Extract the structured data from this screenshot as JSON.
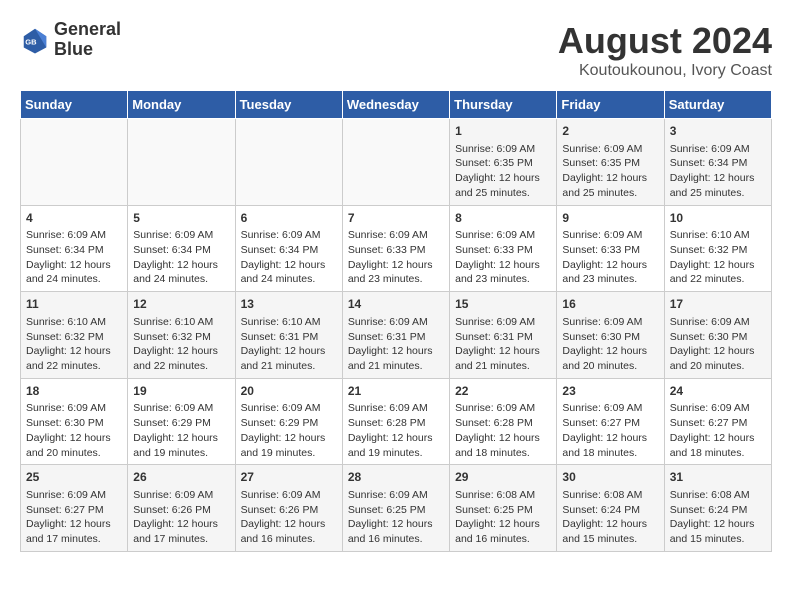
{
  "header": {
    "logo_line1": "General",
    "logo_line2": "Blue",
    "main_title": "August 2024",
    "sub_title": "Koutoukounou, Ivory Coast"
  },
  "calendar": {
    "weekdays": [
      "Sunday",
      "Monday",
      "Tuesday",
      "Wednesday",
      "Thursday",
      "Friday",
      "Saturday"
    ],
    "weeks": [
      [
        {
          "day": "",
          "content": ""
        },
        {
          "day": "",
          "content": ""
        },
        {
          "day": "",
          "content": ""
        },
        {
          "day": "",
          "content": ""
        },
        {
          "day": "1",
          "content": "Sunrise: 6:09 AM\nSunset: 6:35 PM\nDaylight: 12 hours\nand 25 minutes."
        },
        {
          "day": "2",
          "content": "Sunrise: 6:09 AM\nSunset: 6:35 PM\nDaylight: 12 hours\nand 25 minutes."
        },
        {
          "day": "3",
          "content": "Sunrise: 6:09 AM\nSunset: 6:34 PM\nDaylight: 12 hours\nand 25 minutes."
        }
      ],
      [
        {
          "day": "4",
          "content": "Sunrise: 6:09 AM\nSunset: 6:34 PM\nDaylight: 12 hours\nand 24 minutes."
        },
        {
          "day": "5",
          "content": "Sunrise: 6:09 AM\nSunset: 6:34 PM\nDaylight: 12 hours\nand 24 minutes."
        },
        {
          "day": "6",
          "content": "Sunrise: 6:09 AM\nSunset: 6:34 PM\nDaylight: 12 hours\nand 24 minutes."
        },
        {
          "day": "7",
          "content": "Sunrise: 6:09 AM\nSunset: 6:33 PM\nDaylight: 12 hours\nand 23 minutes."
        },
        {
          "day": "8",
          "content": "Sunrise: 6:09 AM\nSunset: 6:33 PM\nDaylight: 12 hours\nand 23 minutes."
        },
        {
          "day": "9",
          "content": "Sunrise: 6:09 AM\nSunset: 6:33 PM\nDaylight: 12 hours\nand 23 minutes."
        },
        {
          "day": "10",
          "content": "Sunrise: 6:10 AM\nSunset: 6:32 PM\nDaylight: 12 hours\nand 22 minutes."
        }
      ],
      [
        {
          "day": "11",
          "content": "Sunrise: 6:10 AM\nSunset: 6:32 PM\nDaylight: 12 hours\nand 22 minutes."
        },
        {
          "day": "12",
          "content": "Sunrise: 6:10 AM\nSunset: 6:32 PM\nDaylight: 12 hours\nand 22 minutes."
        },
        {
          "day": "13",
          "content": "Sunrise: 6:10 AM\nSunset: 6:31 PM\nDaylight: 12 hours\nand 21 minutes."
        },
        {
          "day": "14",
          "content": "Sunrise: 6:09 AM\nSunset: 6:31 PM\nDaylight: 12 hours\nand 21 minutes."
        },
        {
          "day": "15",
          "content": "Sunrise: 6:09 AM\nSunset: 6:31 PM\nDaylight: 12 hours\nand 21 minutes."
        },
        {
          "day": "16",
          "content": "Sunrise: 6:09 AM\nSunset: 6:30 PM\nDaylight: 12 hours\nand 20 minutes."
        },
        {
          "day": "17",
          "content": "Sunrise: 6:09 AM\nSunset: 6:30 PM\nDaylight: 12 hours\nand 20 minutes."
        }
      ],
      [
        {
          "day": "18",
          "content": "Sunrise: 6:09 AM\nSunset: 6:30 PM\nDaylight: 12 hours\nand 20 minutes."
        },
        {
          "day": "19",
          "content": "Sunrise: 6:09 AM\nSunset: 6:29 PM\nDaylight: 12 hours\nand 19 minutes."
        },
        {
          "day": "20",
          "content": "Sunrise: 6:09 AM\nSunset: 6:29 PM\nDaylight: 12 hours\nand 19 minutes."
        },
        {
          "day": "21",
          "content": "Sunrise: 6:09 AM\nSunset: 6:28 PM\nDaylight: 12 hours\nand 19 minutes."
        },
        {
          "day": "22",
          "content": "Sunrise: 6:09 AM\nSunset: 6:28 PM\nDaylight: 12 hours\nand 18 minutes."
        },
        {
          "day": "23",
          "content": "Sunrise: 6:09 AM\nSunset: 6:27 PM\nDaylight: 12 hours\nand 18 minutes."
        },
        {
          "day": "24",
          "content": "Sunrise: 6:09 AM\nSunset: 6:27 PM\nDaylight: 12 hours\nand 18 minutes."
        }
      ],
      [
        {
          "day": "25",
          "content": "Sunrise: 6:09 AM\nSunset: 6:27 PM\nDaylight: 12 hours\nand 17 minutes."
        },
        {
          "day": "26",
          "content": "Sunrise: 6:09 AM\nSunset: 6:26 PM\nDaylight: 12 hours\nand 17 minutes."
        },
        {
          "day": "27",
          "content": "Sunrise: 6:09 AM\nSunset: 6:26 PM\nDaylight: 12 hours\nand 16 minutes."
        },
        {
          "day": "28",
          "content": "Sunrise: 6:09 AM\nSunset: 6:25 PM\nDaylight: 12 hours\nand 16 minutes."
        },
        {
          "day": "29",
          "content": "Sunrise: 6:08 AM\nSunset: 6:25 PM\nDaylight: 12 hours\nand 16 minutes."
        },
        {
          "day": "30",
          "content": "Sunrise: 6:08 AM\nSunset: 6:24 PM\nDaylight: 12 hours\nand 15 minutes."
        },
        {
          "day": "31",
          "content": "Sunrise: 6:08 AM\nSunset: 6:24 PM\nDaylight: 12 hours\nand 15 minutes."
        }
      ]
    ]
  }
}
